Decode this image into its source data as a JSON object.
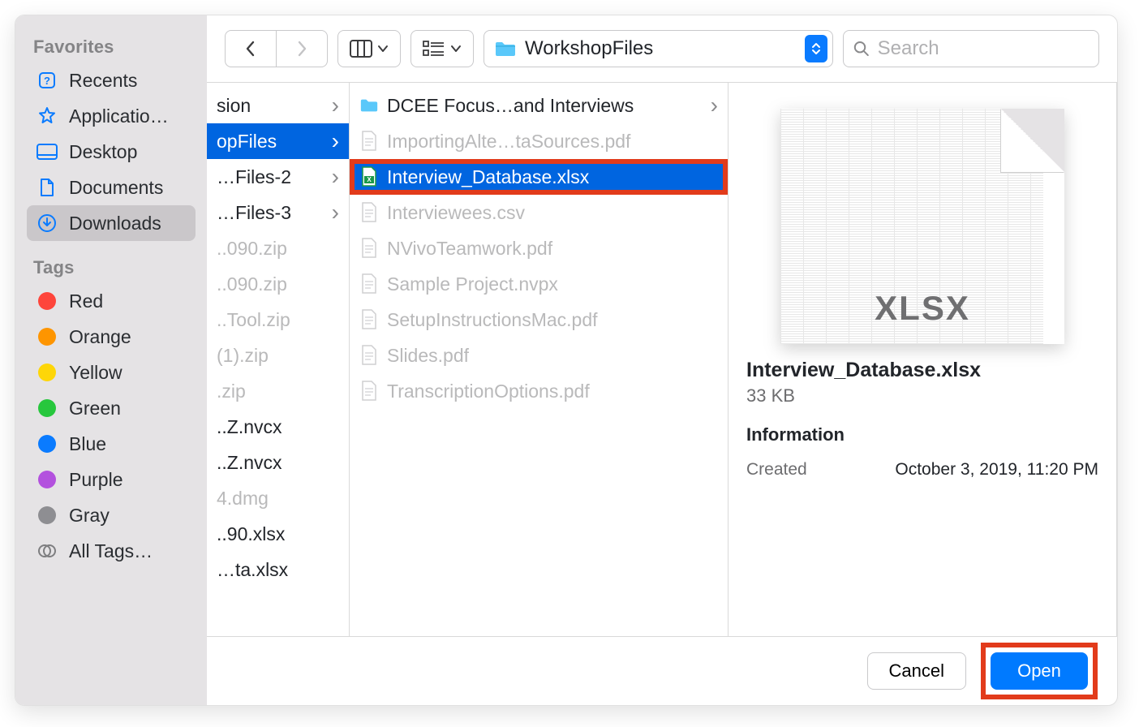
{
  "sidebar": {
    "favorites_heading": "Favorites",
    "tags_heading": "Tags",
    "favorites": [
      {
        "label": "Recents",
        "icon": "clock",
        "selected": false
      },
      {
        "label": "Applicatio…",
        "icon": "apps",
        "selected": false
      },
      {
        "label": "Desktop",
        "icon": "desktop",
        "selected": false
      },
      {
        "label": "Documents",
        "icon": "document",
        "selected": false
      },
      {
        "label": "Downloads",
        "icon": "download",
        "selected": true
      }
    ],
    "tags": [
      {
        "label": "Red",
        "color": "#FE453B"
      },
      {
        "label": "Orange",
        "color": "#FE9500"
      },
      {
        "label": "Yellow",
        "color": "#FED608"
      },
      {
        "label": "Green",
        "color": "#27C73D"
      },
      {
        "label": "Blue",
        "color": "#0A7BFF"
      },
      {
        "label": "Purple",
        "color": "#B351DE"
      },
      {
        "label": "Gray",
        "color": "#8E8E92"
      }
    ],
    "all_tags_label": "All Tags…"
  },
  "toolbar": {
    "location_label": "WorkshopFiles",
    "search_placeholder": "Search"
  },
  "columns": {
    "col1": [
      {
        "name": "sion",
        "hasChildren": true,
        "enabled": true,
        "selected": false
      },
      {
        "name": "opFiles",
        "hasChildren": true,
        "enabled": true,
        "selected": true
      },
      {
        "name": "…Files-2",
        "hasChildren": true,
        "enabled": true,
        "selected": false
      },
      {
        "name": "…Files-3",
        "hasChildren": true,
        "enabled": true,
        "selected": false
      },
      {
        "name": "..090.zip",
        "hasChildren": false,
        "enabled": false
      },
      {
        "name": "..090.zip",
        "hasChildren": false,
        "enabled": false
      },
      {
        "name": "..Tool.zip",
        "hasChildren": false,
        "enabled": false
      },
      {
        "name": "(1).zip",
        "hasChildren": false,
        "enabled": false
      },
      {
        "name": ".zip",
        "hasChildren": false,
        "enabled": false
      },
      {
        "name": "..Z.nvcx",
        "hasChildren": false,
        "enabled": true
      },
      {
        "name": "..Z.nvcx",
        "hasChildren": false,
        "enabled": true
      },
      {
        "name": "4.dmg",
        "hasChildren": false,
        "enabled": false
      },
      {
        "name": "..90.xlsx",
        "hasChildren": false,
        "enabled": true
      },
      {
        "name": "…ta.xlsx",
        "hasChildren": false,
        "enabled": true
      }
    ],
    "col2": [
      {
        "name": "DCEE Focus…and Interviews",
        "type": "folder",
        "enabled": true,
        "hasChildren": true
      },
      {
        "name": "ImportingAlte…taSources.pdf",
        "type": "pdf",
        "enabled": false
      },
      {
        "name": "Interview_Database.xlsx",
        "type": "xlsx",
        "enabled": true,
        "selected": true,
        "highlight": true
      },
      {
        "name": "Interviewees.csv",
        "type": "csv",
        "enabled": false
      },
      {
        "name": "NVivoTeamwork.pdf",
        "type": "pdf",
        "enabled": false
      },
      {
        "name": "Sample Project.nvpx",
        "type": "nvpx",
        "enabled": false
      },
      {
        "name": "SetupInstructionsMac.pdf",
        "type": "pdf",
        "enabled": false
      },
      {
        "name": "Slides.pdf",
        "type": "pdf",
        "enabled": false
      },
      {
        "name": "TranscriptionOptions.pdf",
        "type": "pdf",
        "enabled": false
      }
    ]
  },
  "preview": {
    "badge": "XLSX",
    "filename": "Interview_Database.xlsx",
    "size": "33 KB",
    "info_heading": "Information",
    "created_label": "Created",
    "created_value": "October 3, 2019, 11:20 PM"
  },
  "footer": {
    "cancel": "Cancel",
    "open": "Open"
  },
  "icons": {
    "folder_color": "#5AC8FA",
    "xlsx_color": "#1A9948"
  }
}
